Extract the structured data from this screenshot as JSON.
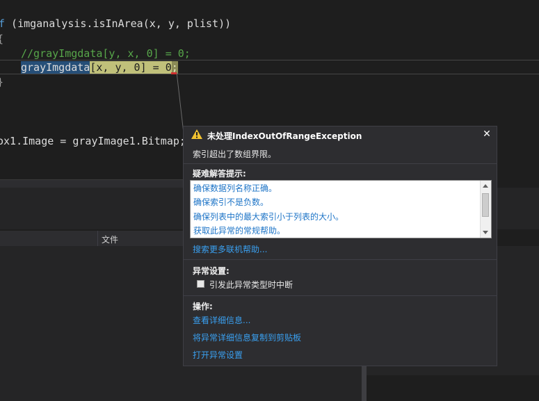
{
  "editor": {
    "line_if_keyword": "f",
    "line_if_rest": " (imganalysis.isInArea(x, y, plist))",
    "brace_open": "{",
    "comment_line": "//grayImgdata[y, x, 0] = 0;",
    "current_selected": "grayImgdata",
    "current_highlighted": "[x, y, 0] = 0",
    "current_end": ";",
    "brace_close": "}",
    "image_line": "ox1.Image = grayImage1.Bitmap;"
  },
  "table": {
    "column_file": "文件"
  },
  "popup": {
    "title": "未处理IndexOutOfRangeException",
    "close_symbol": "✕",
    "message": "索引超出了数组界限。",
    "troubleshooting_title": "疑难解答提示:",
    "tips": [
      "确保数据列名称正确。",
      "确保索引不是负数。",
      "确保列表中的最大索引小于列表的大小。",
      "获取此异常的常规帮助。"
    ],
    "search_more_link": "搜索更多联机帮助...",
    "exception_settings_title": "异常设置:",
    "break_on_type_label": "引发此异常类型时中断",
    "break_on_type_checked": false,
    "actions_title": "操作:",
    "actions": [
      "查看详细信息...",
      "将异常详细信息复制到剪贴板",
      "打开异常设置"
    ]
  },
  "colors": {
    "editor_bg": "#1e1e1e",
    "keyword": "#569cd6",
    "comment": "#57a64a",
    "link": "#3aa0f0",
    "warning": "#f2c230"
  }
}
